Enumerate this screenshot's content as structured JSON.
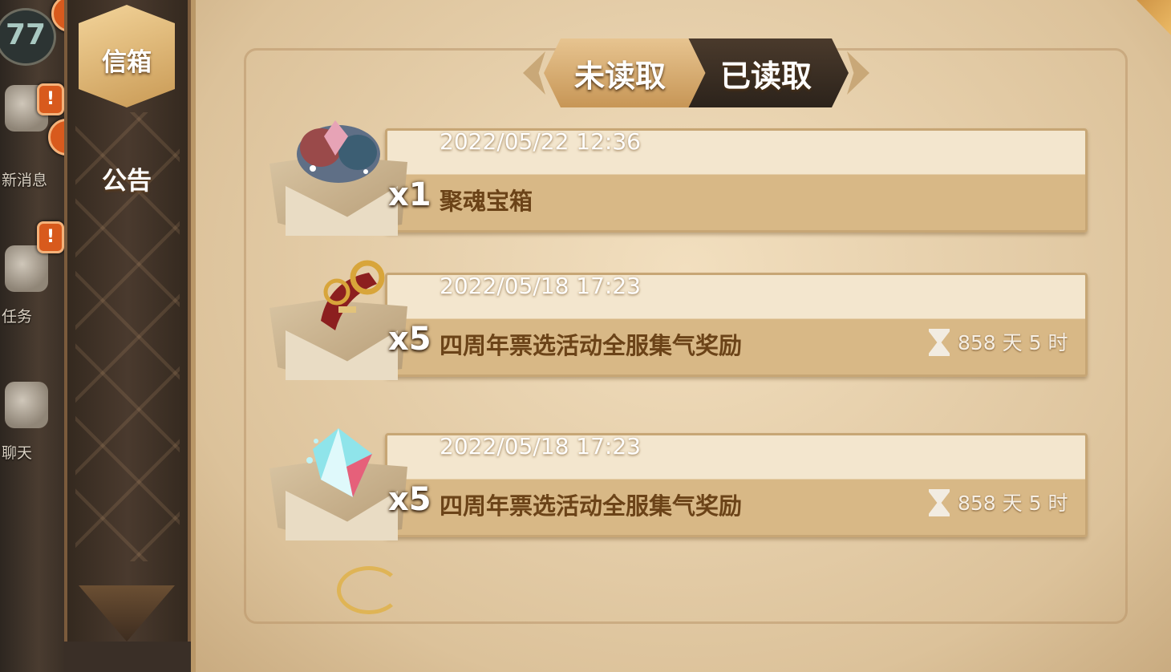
{
  "left_strip": {
    "level": "77",
    "items": [
      {
        "label": "",
        "alert": true
      },
      {
        "label": "新消息",
        "alert": true
      },
      {
        "label": "任务",
        "alert": true
      },
      {
        "label": "聊天",
        "alert": false
      }
    ]
  },
  "sidebar_tabs": {
    "mailbox": "信箱",
    "notice": "公告"
  },
  "read_toggle": {
    "unread": "未读取",
    "read": "已读取",
    "active": "read"
  },
  "mails": [
    {
      "date": "2022/05/22 12:36",
      "title": "聚魂宝箱",
      "qty": "x1",
      "timer": "",
      "item_icon": "soul-chest-icon"
    },
    {
      "date": "2022/05/18 17:23",
      "title": "四周年票选活动全服集气奖励",
      "qty": "x5",
      "timer": "858 天 5 时",
      "item_icon": "ticket-scroll-icon"
    },
    {
      "date": "2022/05/18 17:23",
      "title": "四周年票选活动全服集气奖励",
      "qty": "x5",
      "timer": "858 天 5 时",
      "item_icon": "crystal-icon"
    }
  ],
  "colors": {
    "parchment": "#f2dfbf",
    "title_brown": "#6b4318",
    "alert_orange": "#d85a1d",
    "sidebar_dark": "#34291f"
  }
}
